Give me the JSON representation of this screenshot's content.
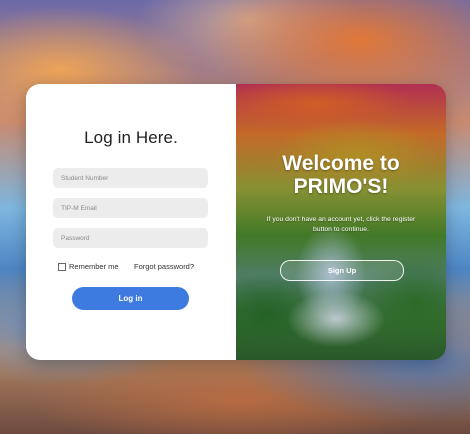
{
  "login": {
    "title": "Log in Here.",
    "student_number_placeholder": "Student Number",
    "email_placeholder": "TIP-M Email",
    "password_placeholder": "Password",
    "remember_label": "Remember me",
    "forgot_label": "Forgot password?",
    "button_label": "Log in"
  },
  "welcome": {
    "title": "Welcome to PRIMO'S!",
    "message": "If you don't have an account yet, click the register button to continue.",
    "signup_label": "Sign Up"
  },
  "colors": {
    "login_button": "#3e7be0",
    "field_background": "#ececec"
  }
}
